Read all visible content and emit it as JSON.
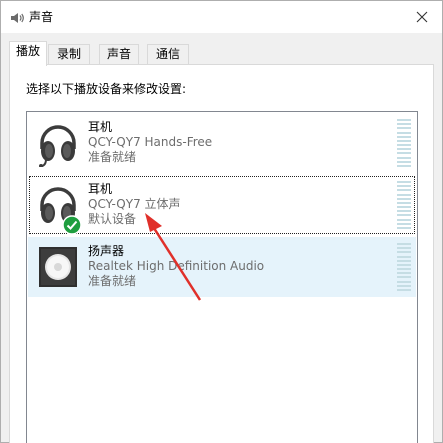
{
  "window": {
    "title": "声音",
    "icon": "speaker-icon",
    "close_label": "✕"
  },
  "tabs": [
    {
      "label": "播放",
      "active": true
    },
    {
      "label": "录制",
      "active": false
    },
    {
      "label": "声音",
      "active": false
    },
    {
      "label": "通信",
      "active": false
    }
  ],
  "instruction": "选择以下播放设备来修改设置:",
  "devices": [
    {
      "name": "耳机",
      "description": "QCY-QY7 Hands-Free",
      "status": "准备就绪",
      "icon": "headset-mic-icon",
      "default": false
    },
    {
      "name": "耳机",
      "description": "QCY-QY7 立体声",
      "status": "默认设备",
      "icon": "headphones-icon",
      "default": true
    },
    {
      "name": "扬声器",
      "description": "Realtek High Definition Audio",
      "status": "准备就绪",
      "icon": "speaker-icon",
      "default": false
    }
  ],
  "colors": {
    "accent_check": "#1e9e3f",
    "annotation_arrow": "#e0302a",
    "row_highlight": "#e5f3fb",
    "level_meter": "#c5dde4"
  }
}
